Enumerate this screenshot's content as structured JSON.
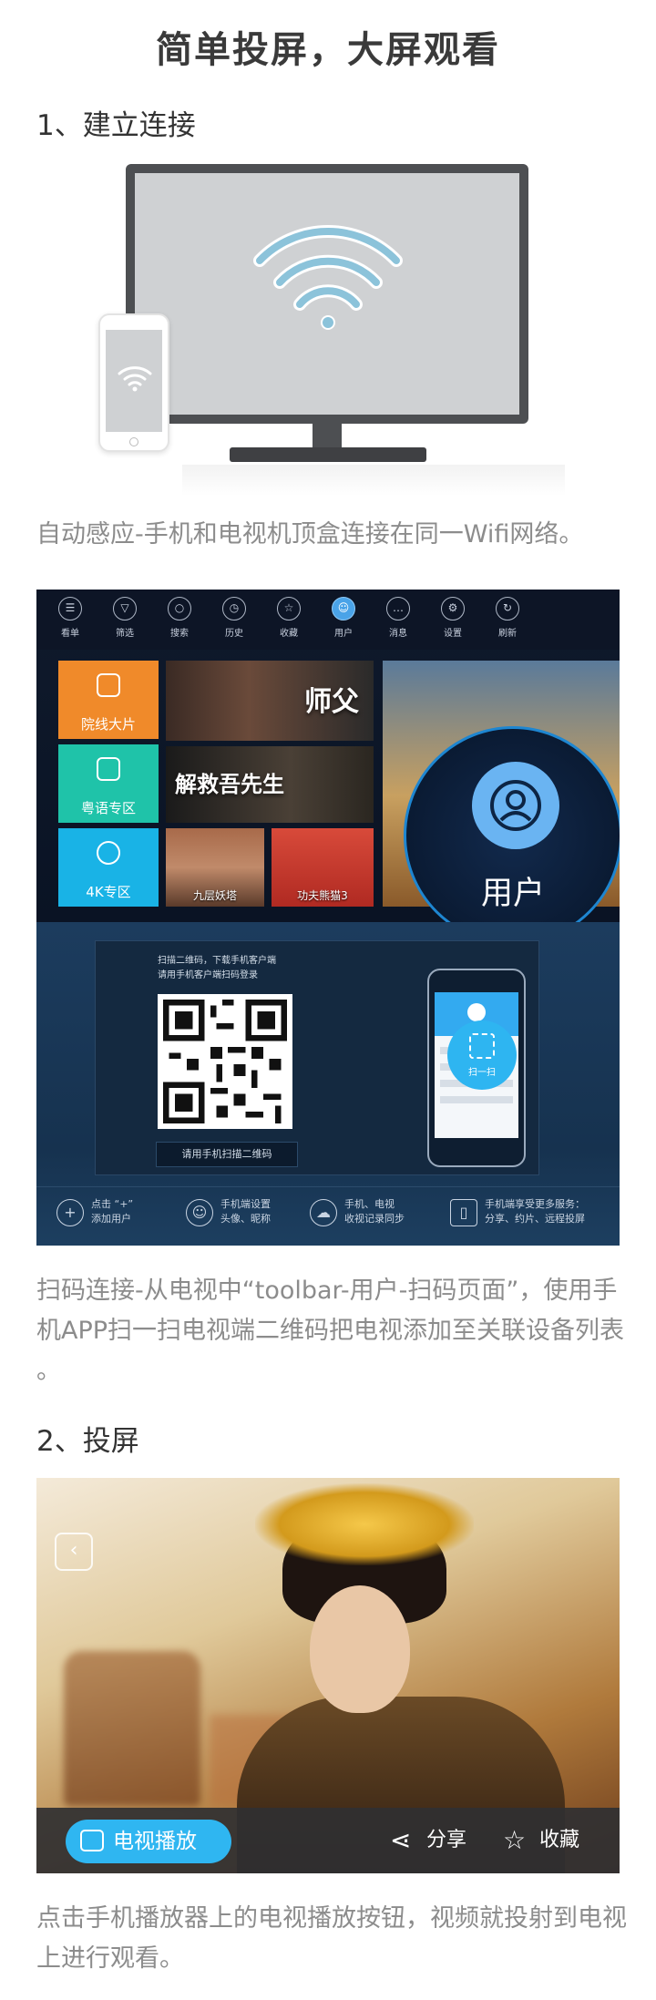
{
  "page_title": "简单投屏，大屏观看",
  "section1": {
    "heading": "1、建立连接",
    "caption1": "自动感应-手机和电视机顶盒连接在同一Wifi网络。",
    "caption2": "扫码连接-从电视中“toolbar-用户-扫码页面”，使用手机APP扫一扫电视端二维码把电视添加至关联设备列表 。"
  },
  "tv_ui": {
    "toolbar": [
      {
        "label": "看单",
        "icon": "list-icon"
      },
      {
        "label": "筛选",
        "icon": "filter-icon"
      },
      {
        "label": "搜索",
        "icon": "search-icon"
      },
      {
        "label": "历史",
        "icon": "history-icon"
      },
      {
        "label": "收藏",
        "icon": "star-icon"
      },
      {
        "label": "用户",
        "icon": "user-icon",
        "active": true
      },
      {
        "label": "消息",
        "icon": "message-icon"
      },
      {
        "label": "设置",
        "icon": "gear-icon"
      },
      {
        "label": "刷新",
        "icon": "refresh-icon"
      }
    ],
    "tiles": [
      {
        "label": "院线大片",
        "color": "#f08a2a"
      },
      {
        "label": "粤语专区",
        "color": "#1fc3a9"
      },
      {
        "label": "4K专区",
        "color": "#19b3e6"
      }
    ],
    "posters": [
      {
        "caption": "",
        "title": "师父"
      },
      {
        "caption": "",
        "title": "解救吾先生"
      },
      {
        "caption": "九层妖塔",
        "title": ""
      },
      {
        "caption": "功夫熊猫3",
        "title": ""
      }
    ],
    "zoom_label": "用户"
  },
  "qr_panel": {
    "hint_lines": [
      "扫描二维码，下载手机客户端",
      "请用手机客户端扫码登录"
    ],
    "button_label": "请用手机扫描二维码",
    "scan_label": "扫一扫",
    "features": [
      {
        "line1": "点击 “+”",
        "line2": "添加用户",
        "icon": "plus-icon"
      },
      {
        "line1": "手机端设置",
        "line2": "头像、昵称",
        "icon": "smile-icon"
      },
      {
        "line1": "手机、电视",
        "line2": "收视记录同步",
        "icon": "cloud-sync-icon"
      },
      {
        "line1": "手机端享受更多服务：",
        "line2": "分享、约片、远程投屏",
        "icon": "phone-service-icon"
      }
    ]
  },
  "section2": {
    "heading": "2、投屏",
    "caption": "点击手机播放器上的电视播放按钮，视频就投射到电视上进行观看。"
  },
  "player": {
    "tv_play_label": "电视播放",
    "share_label": "分享",
    "fav_label": "收藏"
  },
  "colors": {
    "accent_blue": "#2fb6f1",
    "caption_gray": "#8c8c8c",
    "tv_bg": "#0f1a2c"
  }
}
